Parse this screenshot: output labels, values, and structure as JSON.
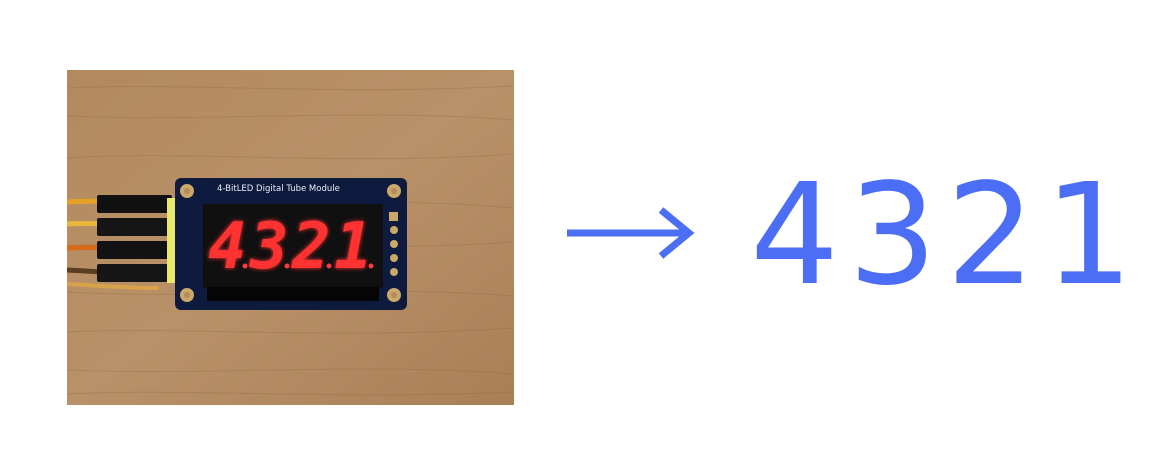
{
  "photo": {
    "module_label": "4-BitLED Digital Tube Module",
    "display_digits": [
      "4",
      "3",
      "2",
      "1"
    ]
  },
  "colors": {
    "accent": "#4c6ef5",
    "wood_background": "#b38c63",
    "pcb": "#0d1a3d",
    "led_red": "#ff2a2a"
  },
  "result": {
    "value": "4321"
  }
}
